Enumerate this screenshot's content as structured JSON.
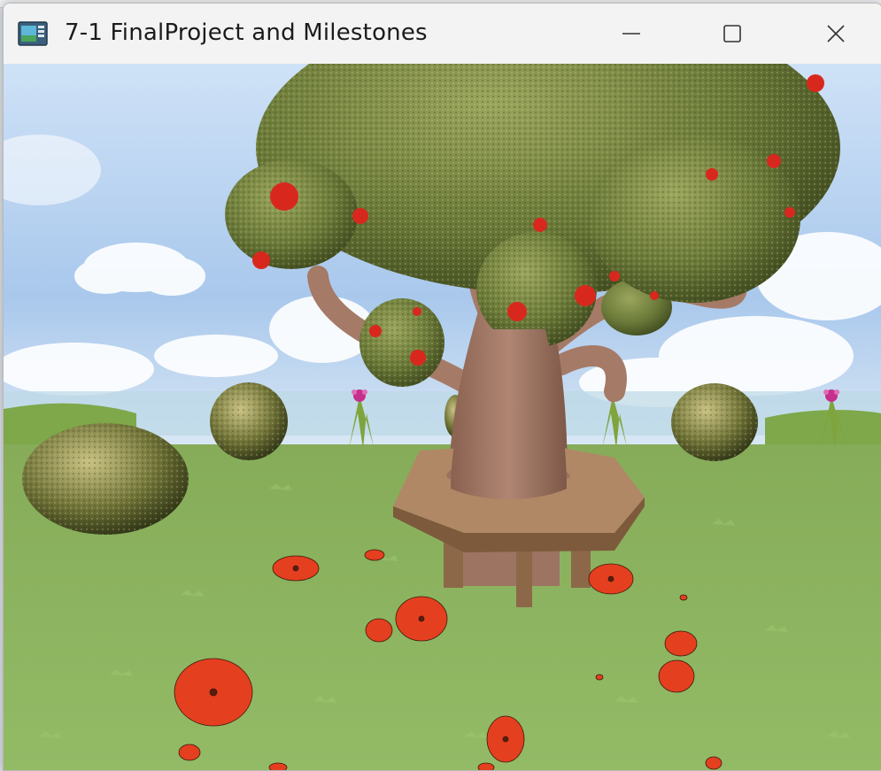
{
  "window": {
    "title": "7-1 FinalProject and Milestones",
    "controls": {
      "minimize": "minimize-icon",
      "maximize": "maximize-icon",
      "close": "close-icon"
    }
  },
  "scene": {
    "sky_color": "#b8d3f0",
    "grass_color": "#8fb661",
    "foliage_color": "#6f7d3a",
    "trunk_color": "#a07560",
    "bench_color": "#a17a59",
    "flower_color": "#e03a1c"
  }
}
